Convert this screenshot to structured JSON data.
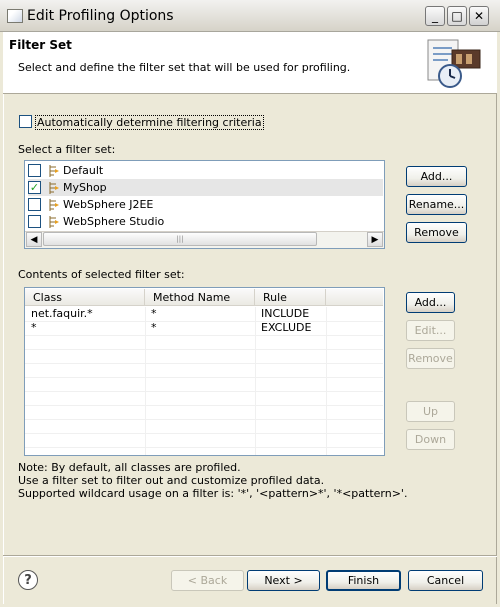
{
  "window": {
    "title": "Edit Profiling Options",
    "controls": {
      "minimize": "_",
      "maximize": "□",
      "close": "✕"
    }
  },
  "header": {
    "title": "Filter Set",
    "description": "Select and define the filter set that will be used for profiling."
  },
  "auto_criteria": {
    "label": "Automatically determine filtering criteria",
    "checked": false
  },
  "filter_sets": {
    "label": "Select a filter set:",
    "items": [
      {
        "label": "Default",
        "checked": false
      },
      {
        "label": "MyShop",
        "checked": true
      },
      {
        "label": "WebSphere J2EE",
        "checked": false
      },
      {
        "label": "WebSphere Studio",
        "checked": false
      }
    ],
    "buttons": {
      "add": "Add...",
      "rename": "Rename...",
      "remove": "Remove"
    }
  },
  "contents": {
    "label": "Contents of selected filter set:",
    "columns": [
      "Class",
      "Method Name",
      "Rule"
    ],
    "rows": [
      [
        "net.faquir.*",
        "*",
        "INCLUDE"
      ],
      [
        "*",
        "*",
        "EXCLUDE"
      ]
    ],
    "buttons": {
      "add": "Add...",
      "edit": "Edit...",
      "remove": "Remove",
      "up": "Up",
      "down": "Down"
    }
  },
  "notes": [
    "Note: By default, all classes are profiled.",
    "Use a filter set to filter out and customize profiled data.",
    "Supported wildcard usage on a filter is: '*', '<pattern>*', '*<pattern>'."
  ],
  "footer": {
    "help": "?",
    "back": "< Back",
    "next": "Next >",
    "finish": "Finish",
    "cancel": "Cancel"
  }
}
